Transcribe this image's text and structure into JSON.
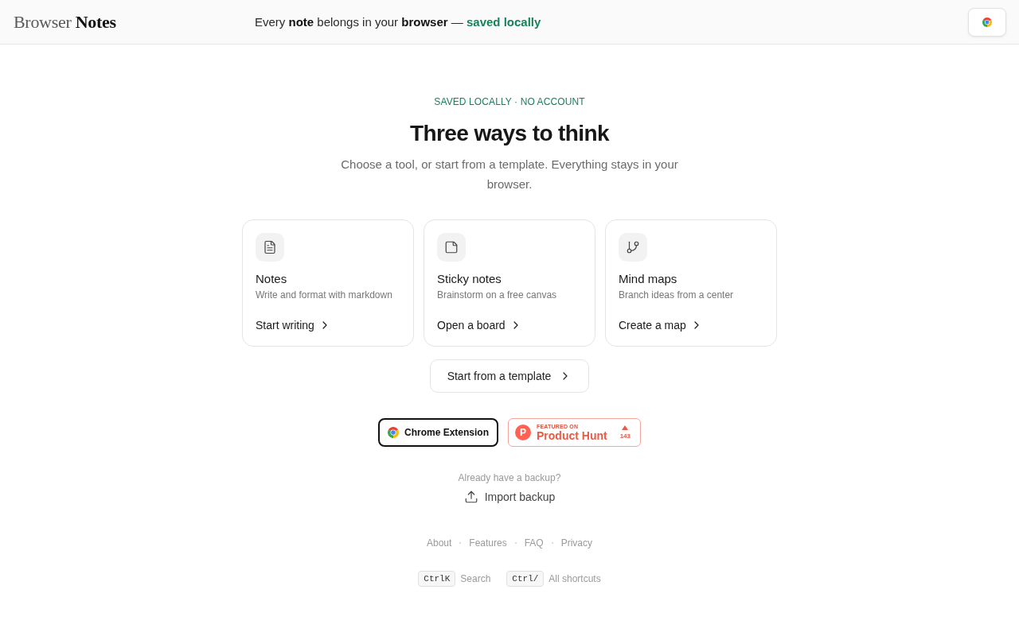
{
  "header": {
    "logo": "Browser **Notes**",
    "tagline": {
      "text": "Every **note** belongs in your **browser** —",
      "highlight": "saved locally"
    }
  },
  "hero": {
    "eyebrow": "SAVED LOCALLY · NO ACCOUNT",
    "title": "Three ways to think",
    "subtitle": "Choose a tool, or start from a template. Everything stays in your browser."
  },
  "tools": [
    {
      "kind": "notes",
      "title": "Notes",
      "description": "Write and format with markdown",
      "action": "Start writing"
    },
    {
      "kind": "sticky",
      "title": "Sticky notes",
      "description": "Brainstorm on a free canvas",
      "action": "Open a board"
    },
    {
      "kind": "mindmap",
      "title": "Mind maps",
      "description": "Branch ideas from a center",
      "action": "Create a map"
    }
  ],
  "template_button": "Start from a template",
  "badges": [
    {
      "kind": "chrome",
      "label": "Chrome Extension"
    },
    {
      "kind": "product_hunt",
      "logo_letter": "P",
      "eyebrow": "FEATURED ON",
      "name": "Product Hunt",
      "count": "143"
    }
  ],
  "backup": {
    "prompt": "Already have a backup?",
    "action": "Import backup"
  },
  "footer_links": [
    "About",
    "Features",
    "FAQ",
    "Privacy"
  ],
  "shortcuts": [
    {
      "keys": "CtrlK",
      "label": "Search"
    },
    {
      "keys": "Ctrl/",
      "label": "All shortcuts"
    }
  ]
}
